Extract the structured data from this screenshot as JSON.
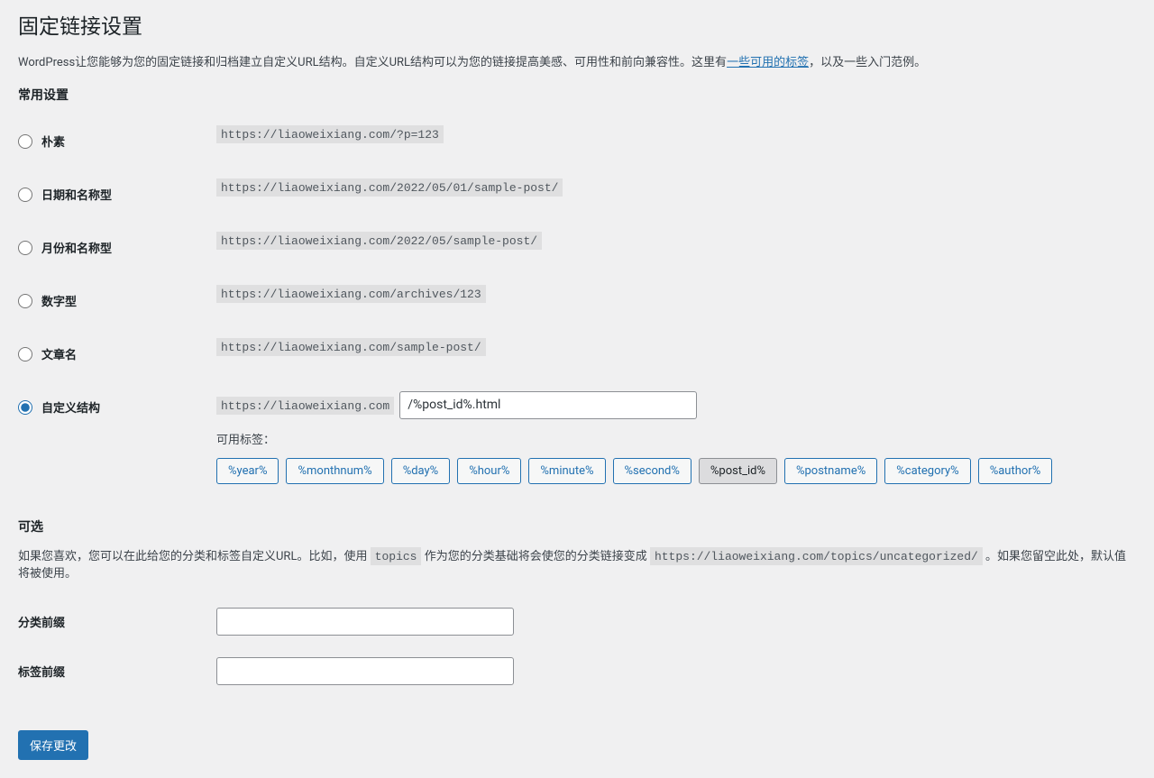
{
  "page_title": "固定链接设置",
  "intro": {
    "text1": "WordPress让您能够为您的固定链接和归档建立自定义URL结构。自定义URL结构可以为您的链接提高美感、可用性和前向兼容性。这里有",
    "link": "一些可用的标签",
    "text2": "，以及一些入门范例。"
  },
  "common_heading": "常用设置",
  "base_url": "https://liaoweixiang.com",
  "options": [
    {
      "label": "朴素",
      "example": "https://liaoweixiang.com/?p=123"
    },
    {
      "label": "日期和名称型",
      "example": "https://liaoweixiang.com/2022/05/01/sample-post/"
    },
    {
      "label": "月份和名称型",
      "example": "https://liaoweixiang.com/2022/05/sample-post/"
    },
    {
      "label": "数字型",
      "example": "https://liaoweixiang.com/archives/123"
    },
    {
      "label": "文章名",
      "example": "https://liaoweixiang.com/sample-post/"
    }
  ],
  "custom": {
    "label": "自定义结构",
    "value": "/%post_id%.html",
    "available_tags_label": "可用标签：",
    "tags": [
      "%year%",
      "%monthnum%",
      "%day%",
      "%hour%",
      "%minute%",
      "%second%",
      "%post_id%",
      "%postname%",
      "%category%",
      "%author%"
    ]
  },
  "optional": {
    "heading": "可选",
    "desc_1": "如果您喜欢，您可以在此给您的分类和标签自定义URL。比如，使用 ",
    "desc_code1": "topics",
    "desc_2": " 作为您的分类基础将会使您的分类链接变成 ",
    "desc_code2": "https://liaoweixiang.com/topics/uncategorized/",
    "desc_3": " 。如果您留空此处，默认值将被使用。",
    "category_label": "分类前缀",
    "tag_label": "标签前缀"
  },
  "submit_label": "保存更改"
}
